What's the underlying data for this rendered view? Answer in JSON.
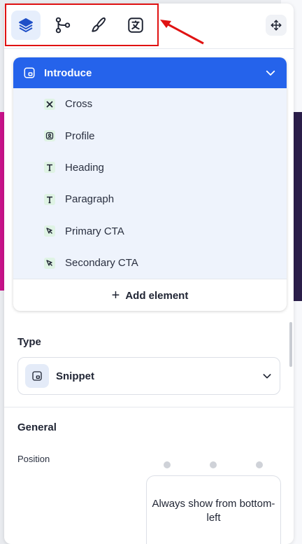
{
  "toolbar": {
    "tools": [
      {
        "icon": "layers-icon",
        "active": true
      },
      {
        "icon": "branch-icon",
        "active": false
      },
      {
        "icon": "brush-icon",
        "active": false
      },
      {
        "icon": "translate-icon",
        "active": false
      }
    ],
    "move_icon": "move-icon"
  },
  "layers": {
    "header": "Introduce",
    "items": [
      {
        "label": "Cross",
        "icon": "cross-icon"
      },
      {
        "label": "Profile",
        "icon": "profile-icon"
      },
      {
        "label": "Heading",
        "icon": "text-icon"
      },
      {
        "label": "Paragraph",
        "icon": "text-icon"
      },
      {
        "label": "Primary CTA",
        "icon": "cursor-icon"
      },
      {
        "label": "Secondary CTA",
        "icon": "cursor-icon"
      }
    ],
    "add_label": "Add element"
  },
  "type_section": {
    "label": "Type",
    "selected": "Snippet"
  },
  "general_section": {
    "label": "General",
    "position_label": "Position",
    "position_value": "Always show from bottom-left"
  },
  "colors": {
    "accent": "#2563eb",
    "highlight": "#e01212",
    "list_bg": "#eef3fc"
  }
}
